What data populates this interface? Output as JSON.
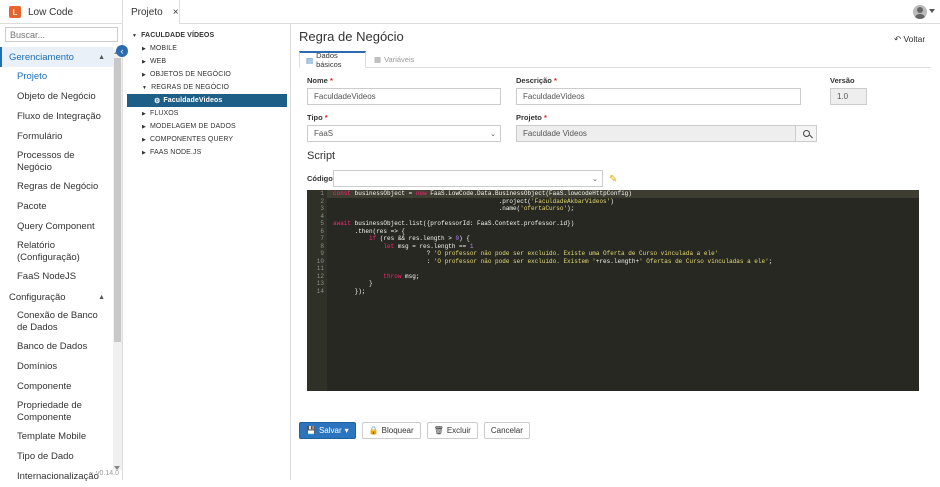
{
  "app": {
    "title": "Low Code",
    "logo_letter": "L"
  },
  "tabs": [
    {
      "label": "Projeto",
      "close": "×"
    }
  ],
  "sidebar": {
    "search_placeholder": "Buscar...",
    "collapse_icon": "‹",
    "groups": [
      {
        "label": "Gerenciamento",
        "expanded": true,
        "caret": "▲"
      },
      {
        "label": "Configuração",
        "expanded": true,
        "caret": "▲"
      }
    ],
    "items_gerenciamento": [
      "Projeto",
      "Objeto de Negócio",
      "Fluxo de Integração",
      "Formulário",
      "Processos de Negócio",
      "Regras de Negócio",
      "Pacote",
      "Query Component",
      "Relatório (Configuração)",
      "FaaS NodeJS"
    ],
    "items_configuracao": [
      "Conexão de Banco de Dados",
      "Banco de Dados",
      "Domínios",
      "Componente",
      "Propriedade de Componente",
      "Template Mobile",
      "Tipo de Dado",
      "Internacionalização"
    ],
    "version": "v0.14.0"
  },
  "tree": {
    "root": "FACULDADE VÍDEOS",
    "items": [
      "MOBILE",
      "WEB",
      "OBJETOS DE NEGÓCIO",
      "REGRAS DE NEGÓCIO"
    ],
    "selected": "FaculdadeVideos",
    "items_after": [
      "FLUXOS",
      "MODELAGEM DE DADOS",
      "COMPONENTES QUERY",
      "FAAS NODE.JS"
    ]
  },
  "main": {
    "title": "Regra de Negócio",
    "back_label": "Voltar",
    "tab_basic": "Dados básicos",
    "tab_vars": "Variáveis",
    "nome_label": "Nome",
    "nome_value": "FaculdadeVideos",
    "descricao_label": "Descrição",
    "descricao_value": "FaculdadeVideos",
    "versao_label": "Versão",
    "versao_value": "1.0",
    "tipo_label": "Tipo",
    "tipo_value": "FaaS",
    "projeto_label": "Projeto",
    "projeto_value": "Faculdade Videos",
    "required_mark": "*",
    "script_title": "Script",
    "codigo_label": "Código",
    "codigo_value": ""
  },
  "code_lines": [
    "const businessObject = new FaaS.LowCode.Data.BusinessObject(FaaS.lowcodeHttpConfig)",
    "                                              .project('FaculdadeAkbarVideos')",
    "                                              .name('ofertaCurso');",
    "",
    "await businessObject.list({professorId: FaaS.Context.professor.id})",
    "      .then(res => {",
    "          if (res && res.length > 0) {",
    "              let msg = res.length == 1",
    "                          ? 'O professor não pode ser excluído. Existe uma Oferta de Curso vinculada a ele'",
    "                          : 'O professor não pode ser excluído. Existem '+res.length+' Ofertas de Curso vinculadas a ele';",
    "",
    "              throw msg;",
    "          }",
    "      });"
  ],
  "actions": {
    "save": "Salvar",
    "lock": "Bloquear",
    "delete": "Excluir",
    "cancel": "Cancelar"
  },
  "colors": {
    "accent": "#2b75c0",
    "selected_tree": "#1e5f87",
    "editor_bg": "#272822"
  }
}
